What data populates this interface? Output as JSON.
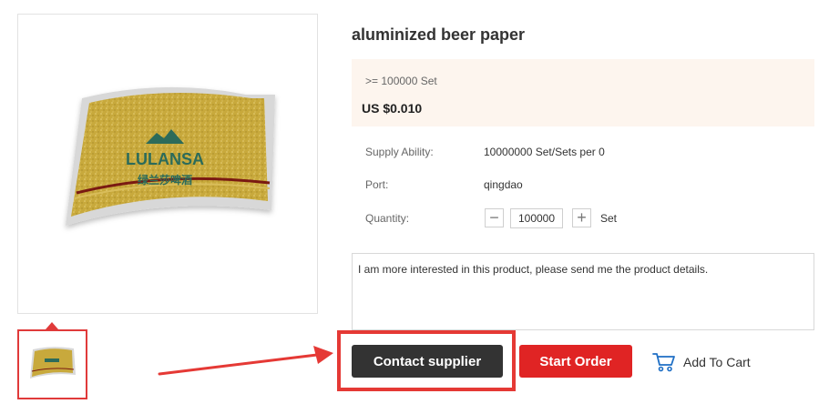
{
  "product": {
    "title": "aluminized beer paper",
    "label_brand": "LULANSA",
    "label_chinese": "绿兰莎啤酒"
  },
  "price": {
    "tier": ">= 100000  Set",
    "value": "US $0.010"
  },
  "specs": {
    "supply_label": "Supply Ability:",
    "supply_value": "10000000 Set/Sets per 0",
    "port_label": "Port:",
    "port_value": "qingdao",
    "quantity_label": "Quantity:",
    "quantity_value": "100000",
    "quantity_unit": "Set"
  },
  "message": {
    "text": "I am more interested in this product, please send me the product details."
  },
  "actions": {
    "contact_label": "Contact supplier",
    "order_label": "Start Order",
    "cart_label": "Add To Cart"
  },
  "colors": {
    "accent_red": "#e02424",
    "highlight_red": "#e53935",
    "dark_button": "#333333",
    "price_bg": "#fdf5ee",
    "label_gold": "#c9a93a",
    "cart_icon": "#1f6fc5"
  },
  "icons": {
    "minus": "minus-icon",
    "plus": "plus-icon",
    "cart": "cart-icon",
    "arrow": "arrow-annotation"
  }
}
